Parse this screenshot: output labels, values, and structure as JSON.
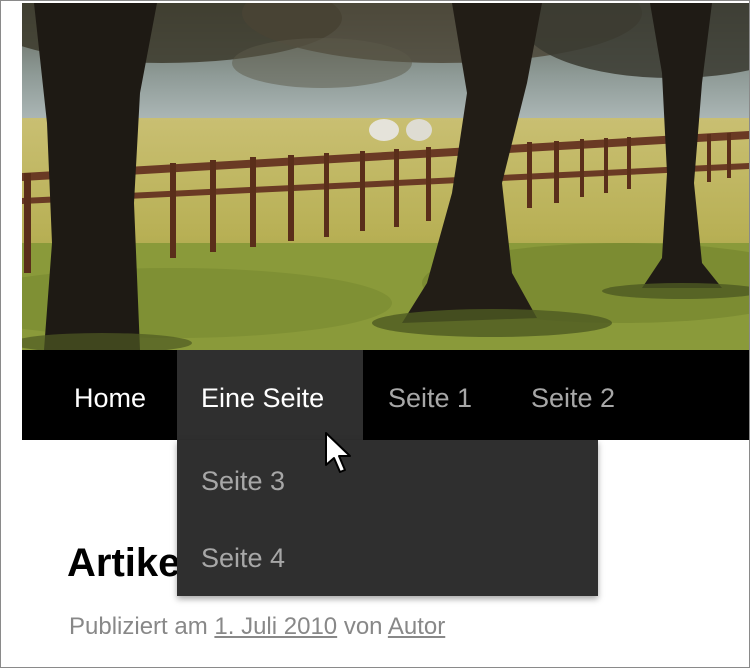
{
  "nav": {
    "items": [
      {
        "label": "Home"
      },
      {
        "label": "Eine Seite"
      },
      {
        "label": "Seite 1"
      },
      {
        "label": "Seite 2"
      }
    ],
    "submenu": [
      {
        "label": "Seite 3"
      },
      {
        "label": "Seite 4"
      }
    ],
    "colors": {
      "bar": "#000000",
      "active": "#2f2f2f",
      "inactive_text": "#a7a7a7"
    }
  },
  "article": {
    "title": "Artikel",
    "meta_prefix": "Publiziert am",
    "date": "1. Juli 2010",
    "by": "von",
    "author": "Autor"
  },
  "icons": {
    "cursor": "arrow-cursor-icon"
  }
}
